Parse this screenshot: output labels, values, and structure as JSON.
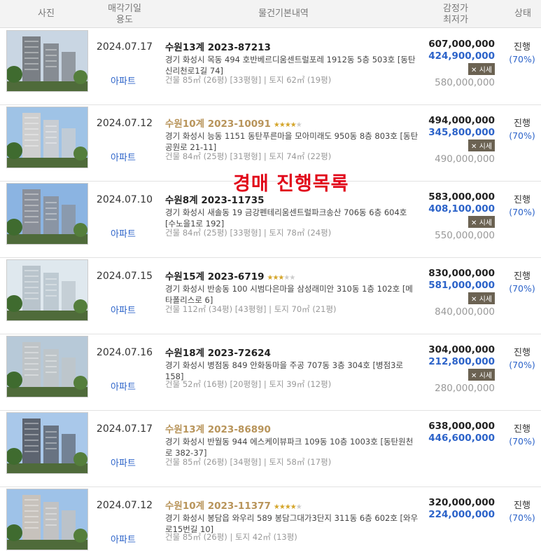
{
  "header": {
    "photo": "사진",
    "date_line1": "매각기일",
    "date_line2": "용도",
    "info": "물건기본내역",
    "price_line1": "감정가",
    "price_line2": "최저가",
    "status": "상태"
  },
  "overlay_text": "경매  진행목록",
  "badge_label": "시세",
  "rows": [
    {
      "date": "2024.07.17",
      "type": "아파트",
      "case": "수원13계 2023-87213",
      "gold": false,
      "stars": 0,
      "addr": "경기 화성시 목동 494 호반베르디움센트럴포레 1912동 5층 503호 [동탄신리천로1길 74]",
      "area": "건물 85㎡ (26평) [33평형]  |  토지 62㎡ (19평)",
      "appraisal": "607,000,000",
      "minimum": "424,900,000",
      "sale": "580,000,000",
      "status": "진행",
      "pct": "(70%)"
    },
    {
      "date": "2024.07.12",
      "type": "아파트",
      "case": "수원10계 2023-10091",
      "gold": true,
      "stars": 4,
      "addr": "경기 화성시 능동 1151 동탄푸른마을 모아미래도 950동 8층 803호 [동탄공원로 21-11]",
      "area": "건물 84㎡ (25평) [31평형]  |  토지 74㎡ (22평)",
      "appraisal": "494,000,000",
      "minimum": "345,800,000",
      "sale": "490,000,000",
      "status": "진행",
      "pct": "(70%)"
    },
    {
      "date": "2024.07.10",
      "type": "아파트",
      "case": "수원8계 2023-11735",
      "gold": false,
      "stars": 0,
      "addr": "경기 화성시 새솔동 19 금강펜테리움센트럴파크송산 706동 6층 604호 [수노을1로 192]",
      "area": "건물 84㎡ (25평) [33평형]  |  토지 78㎡ (24평)",
      "appraisal": "583,000,000",
      "minimum": "408,100,000",
      "sale": "550,000,000",
      "status": "진행",
      "pct": "(70%)"
    },
    {
      "date": "2024.07.15",
      "type": "아파트",
      "case": "수원15계 2023-6719",
      "gold": false,
      "stars": 3,
      "addr": "경기 화성시 반송동 100 시범다은마을 삼성래미안 310동 1층 102호 [메타폴리스로 6]",
      "area": "건물 112㎡ (34평) [43평형]  |  토지 70㎡ (21평)",
      "appraisal": "830,000,000",
      "minimum": "581,000,000",
      "sale": "840,000,000",
      "status": "진행",
      "pct": "(70%)"
    },
    {
      "date": "2024.07.16",
      "type": "아파트",
      "case": "수원18계 2023-72624",
      "gold": false,
      "stars": 0,
      "addr": "경기 화성시 병점동 849 안화동마을 주공 707동 3층 304호 [병점3로 158]",
      "area": "건물 52㎡ (16평) [20평형]  |  토지 39㎡ (12평)",
      "appraisal": "304,000,000",
      "minimum": "212,800,000",
      "sale": "280,000,000",
      "status": "진행",
      "pct": "(70%)"
    },
    {
      "date": "2024.07.17",
      "type": "아파트",
      "case": "수원13계 2023-86890",
      "gold": true,
      "stars": 0,
      "addr": "경기 화성시 반월동 944 에스케이뷰파크 109동 10층 1003호 [동탄원천로 382-37]",
      "area": "건물 85㎡ (26평) [34평형]  |  토지 58㎡ (17평)",
      "appraisal": "638,000,000",
      "minimum": "446,600,000",
      "sale": "",
      "status": "진행",
      "pct": "(70%)"
    },
    {
      "date": "2024.07.12",
      "type": "아파트",
      "case": "수원10계 2023-11377",
      "gold": true,
      "stars": 4,
      "addr": "경기 화성시 봉담읍 와우리 589 봉담그대가3단지 311동 6층 602호 [와우로15번길 10]",
      "area": "건물 85㎡ (26평)  |  토지 42㎡ (13평)",
      "appraisal": "320,000,000",
      "minimum": "224,000,000",
      "sale": "",
      "status": "진행",
      "pct": "(70%)"
    }
  ]
}
